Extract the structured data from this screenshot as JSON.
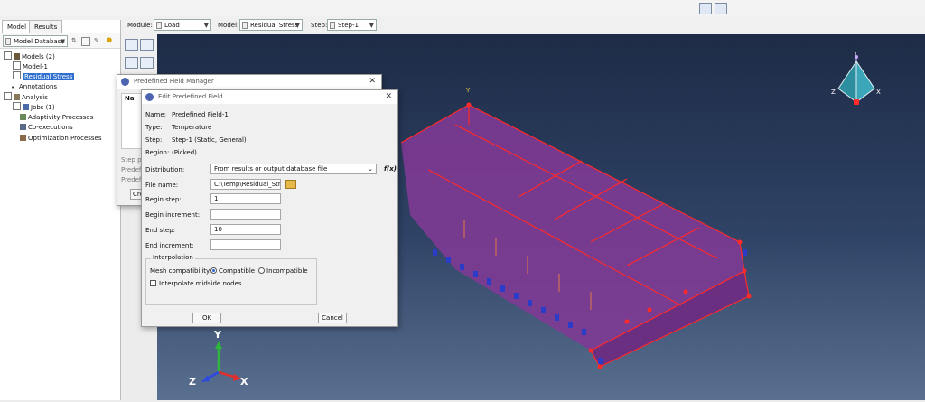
{
  "tabs": [
    "Model",
    "Results"
  ],
  "context_bar": {
    "module_label": "Module:",
    "module_value": "Load",
    "model_label": "Model:",
    "model_value": "Residual Stress",
    "step_label": "Step:",
    "step_value": "Step-1"
  },
  "tree": {
    "database_combo": "Model Database",
    "items": [
      "Models (2)",
      "Model-1",
      "Residual Stress",
      "Annotations",
      "Analysis",
      "Jobs (1)",
      "Adaptivity Processes",
      "Co-executions",
      "Optimization Processes"
    ]
  },
  "manager_dialog": {
    "title": "Predefined Field Manager",
    "column_header": "Na",
    "side_labels": [
      "Step pr",
      "Predefi",
      "Predefi"
    ],
    "create_button": "Cre"
  },
  "edit_dialog": {
    "title": "Edit Predefined Field",
    "info": [
      {
        "label": "Name:",
        "value": "Predefined Field-1"
      },
      {
        "label": "Type:",
        "value": "Temperature"
      },
      {
        "label": "Step:",
        "value": "Step-1 (Static, General)"
      },
      {
        "label": "Region:",
        "value": "(Picked)"
      }
    ],
    "distribution_label": "Distribution:",
    "distribution_value": "From results or output database file",
    "fx": "f(x)",
    "file_name_label": "File name:",
    "file_name_value": "C:\\Temp\\Residual_Stre",
    "begin_step_label": "Begin step:",
    "begin_step_value": "1",
    "begin_increment_label": "Begin increment:",
    "begin_increment_value": "",
    "end_step_label": "End step:",
    "end_step_value": "10",
    "end_increment_label": "End increment:",
    "end_increment_value": "",
    "interpolation_title": "Interpolation",
    "mesh_compat_label": "Mesh compatibility:",
    "compatible_label": "Compatible",
    "incompatible_label": "Incompatible",
    "midside_label": "Interpolate midside nodes",
    "ok_label": "OK",
    "cancel_label": "Cancel"
  },
  "triad": {
    "x": "X",
    "y": "Y",
    "z": "Z"
  },
  "view_cube": {
    "y": "Y",
    "x": "X",
    "z": "Z"
  },
  "colors": {
    "viewport_top": "#1d2b46",
    "part_fill": "#7e3a93",
    "edge": "#ff2a2a",
    "selection": "#2f6fd0"
  }
}
